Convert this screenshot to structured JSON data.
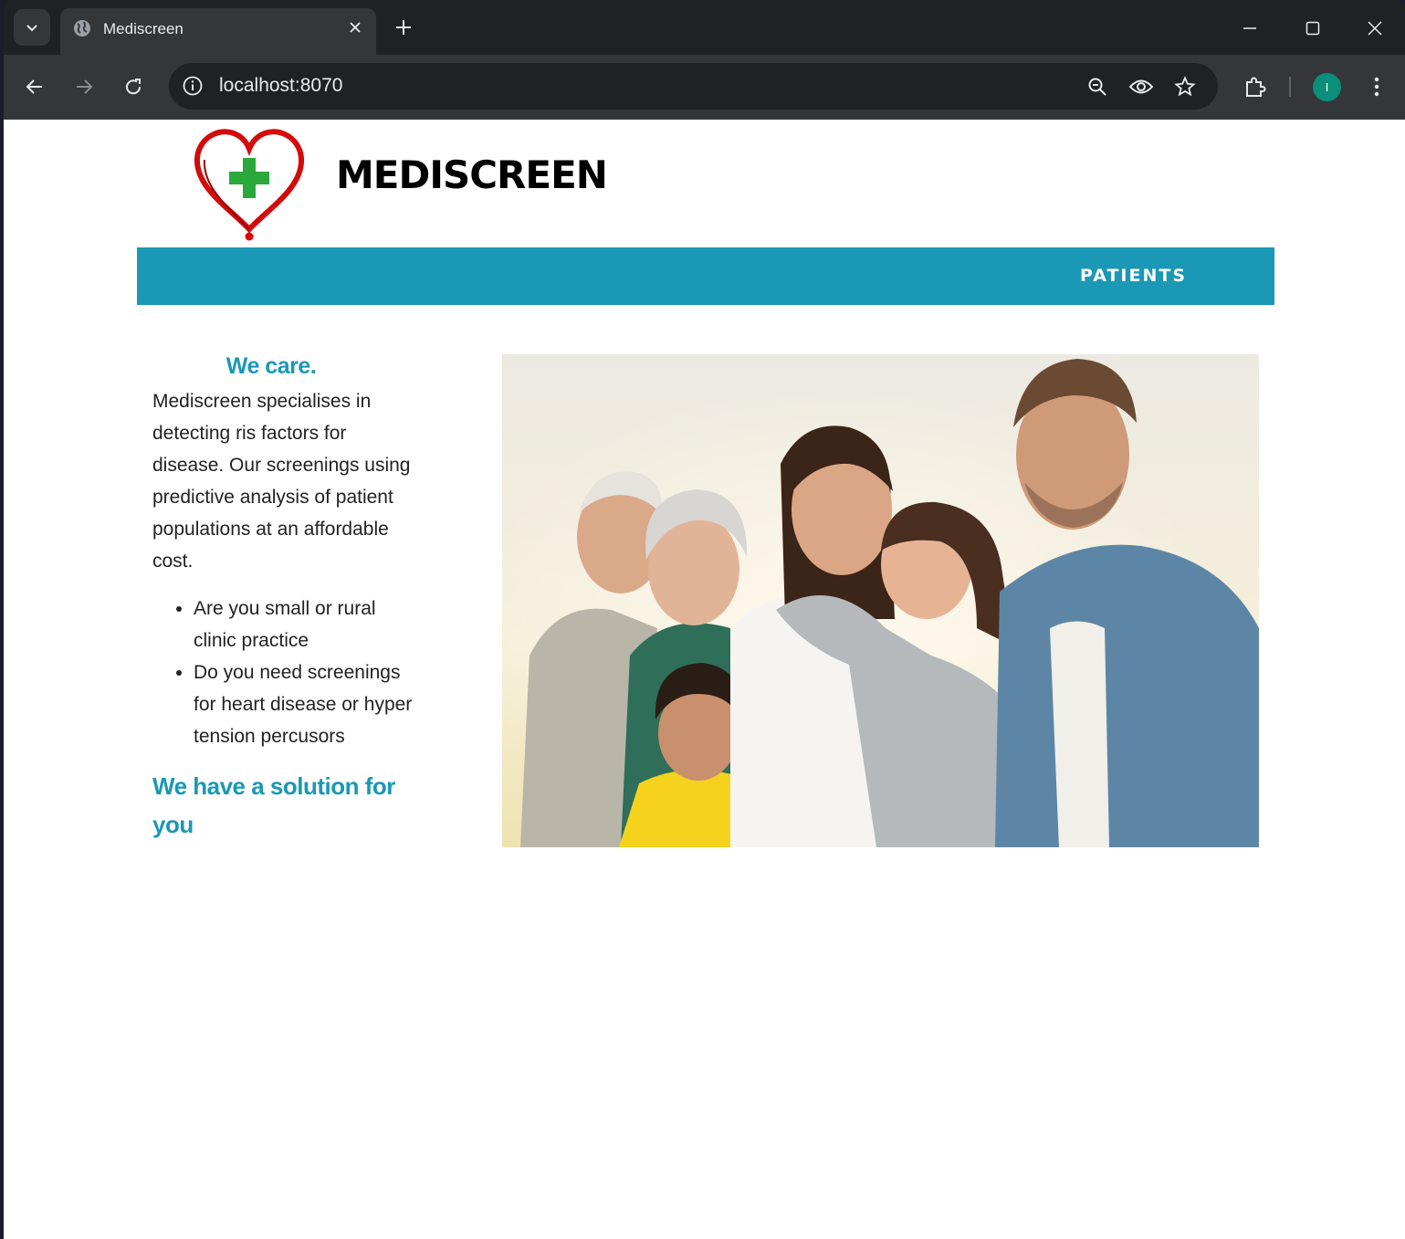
{
  "browser": {
    "tab_title": "Mediscreen",
    "url": "localhost:8070",
    "profile_initial": "I",
    "icons": [
      "tab-search-icon",
      "globe-icon",
      "close-icon",
      "plus-icon",
      "minimize-icon",
      "maximize-icon",
      "window-close-icon",
      "back-icon",
      "forward-icon",
      "reload-icon",
      "info-icon",
      "zoom-out-icon",
      "eye-icon",
      "star-icon",
      "extensions-icon",
      "kebab-menu-icon"
    ]
  },
  "site": {
    "brand": "MEDISCREEN",
    "nav": {
      "patients": "PATIENTS"
    },
    "accent_color": "#1a98b5",
    "heading": "We care.",
    "intro": "Mediscreen specialises in detecting ris factors for disease. Our screenings using predictive analysis of patient populations at an affordable cost.",
    "bullets": [
      "Are you small or rural clinic practice",
      "Do you need screenings for heart disease or hyper tension percusors"
    ],
    "closing": "We have a solution for you"
  }
}
